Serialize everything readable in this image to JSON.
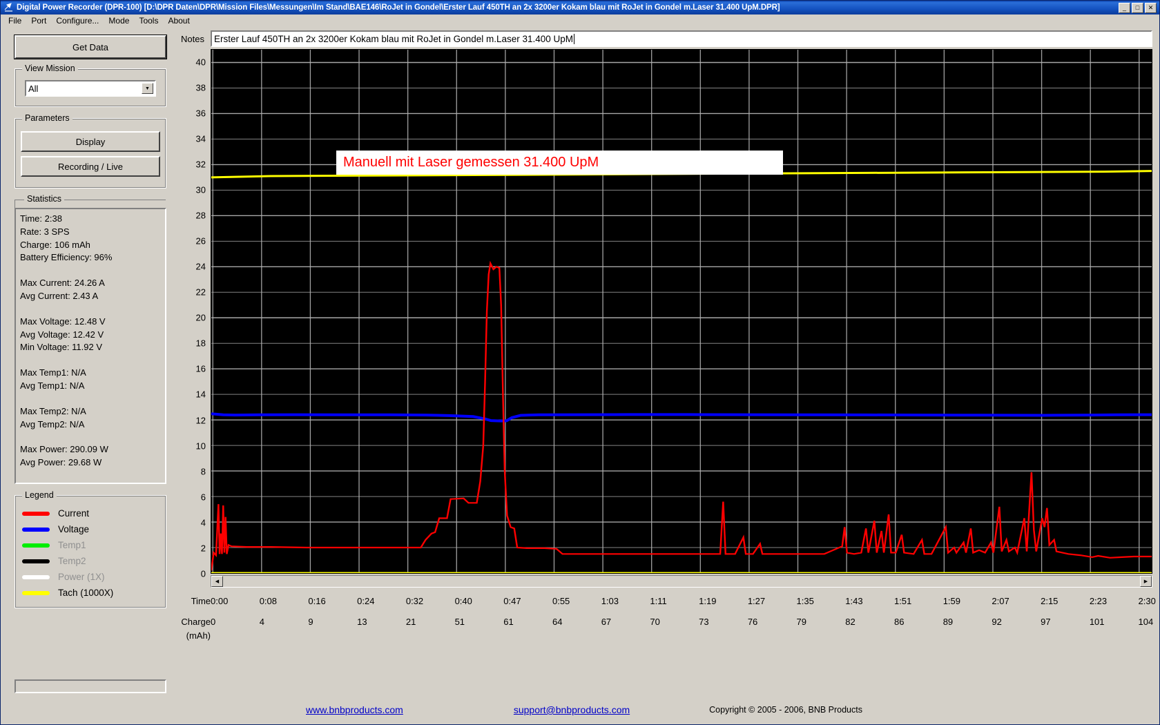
{
  "window": {
    "title": "Digital Power Recorder (DPR-100) [D:\\DPR Daten\\DPR\\Mission Files\\Messungen\\Im Stand\\BAE146\\RoJet in Gondel\\Erster Lauf 450TH an 2x 3200er Kokam blau mit RoJet in Gondel m.Laser 31.400 UpM.DPR]",
    "icon": "app-icon",
    "minimize": "_",
    "maximize": "□",
    "close": "✕"
  },
  "menu": {
    "items": [
      "File",
      "Port",
      "Configure...",
      "Mode",
      "Tools",
      "About"
    ]
  },
  "sidebar": {
    "get_data_label": "Get Data",
    "view_mission": {
      "title": "View Mission",
      "selected": "All",
      "options": [
        "All"
      ],
      "arrow": "▼"
    },
    "parameters": {
      "title": "Parameters",
      "display_label": "Display",
      "recording_label": "Recording / Live"
    },
    "statistics": {
      "title": "Statistics",
      "lines": [
        "Time: 2:38",
        "Rate: 3 SPS",
        "Charge: 106 mAh",
        "Battery Efficiency: 96%",
        "",
        "Max Current: 24.26 A",
        "Avg Current: 2.43 A",
        "",
        "Max Voltage: 12.48 V",
        "Avg Voltage: 12.42 V",
        "Min Voltage: 11.92 V",
        "",
        "Max Temp1: N/A",
        "Avg Temp1: N/A",
        "",
        "Max Temp2: N/A",
        "Avg Temp2: N/A",
        "",
        "Max Power: 290.09 W",
        "Avg Power: 29.68 W"
      ]
    },
    "legend": {
      "title": "Legend",
      "entries": [
        {
          "label": "Current",
          "color": "#ff0000",
          "enabled": true
        },
        {
          "label": "Voltage",
          "color": "#0000ff",
          "enabled": true
        },
        {
          "label": "Temp1",
          "color": "#00ee00",
          "enabled": false
        },
        {
          "label": "Temp2",
          "color": "#000000",
          "enabled": true
        },
        {
          "label": "Power  (1X)",
          "color": "#ffffff",
          "enabled": false
        },
        {
          "label": "Tach   (1000X)",
          "color": "#ffff00",
          "enabled": true
        }
      ]
    }
  },
  "notes": {
    "label": "Notes",
    "value": "Erster Lauf 450TH an 2x 3200er Kokam blau mit RoJet in Gondel m.Laser 31.400 UpM",
    "placeholder": ""
  },
  "scrollbar": {
    "left_arrow": "◀",
    "right_arrow": "▶"
  },
  "footer": {
    "website": "www.bnbproducts.com",
    "email": "support@bnbproducts.com",
    "copyright": "Copyright © 2005 - 2006, BNB Products"
  },
  "chart_data": {
    "type": "line",
    "title": "",
    "annotation": "Manuell mit Laser gemessen 31.400 UpM",
    "annotation_color": "#ff0000",
    "annotation_bg": "#ffffff",
    "plot_bg": "#000000",
    "grid": true,
    "grid_color": "#b0b0b0",
    "ylabel": "",
    "ylim": [
      0,
      41
    ],
    "yticks": [
      0,
      2,
      4,
      6,
      8,
      10,
      12,
      14,
      16,
      18,
      20,
      22,
      24,
      26,
      28,
      30,
      32,
      34,
      36,
      38,
      40
    ],
    "xlabel_time": "Time",
    "xlabel_charge": "Charge",
    "xlabel_charge_unit": "(mAh)",
    "xticks_time": [
      "0:00",
      "0:08",
      "0:16",
      "0:24",
      "0:32",
      "0:40",
      "0:47",
      "0:55",
      "1:03",
      "1:11",
      "1:19",
      "1:27",
      "1:35",
      "1:43",
      "1:51",
      "1:59",
      "2:07",
      "2:15",
      "2:23",
      "2:30"
    ],
    "xticks_charge": [
      "0",
      "4",
      "9",
      "13",
      "21",
      "51",
      "61",
      "64",
      "67",
      "70",
      "73",
      "76",
      "79",
      "82",
      "86",
      "89",
      "92",
      "97",
      "101",
      "104"
    ],
    "xlim": [
      0,
      158
    ],
    "legend_position": "left-panel",
    "series": [
      {
        "name": "Current",
        "color": "#ff0000",
        "unit": "A",
        "max": 24.26,
        "avg": 2.43,
        "points": [
          [
            0,
            0.2
          ],
          [
            0.4,
            1.6
          ],
          [
            0.8,
            1.4
          ],
          [
            1.2,
            5.4
          ],
          [
            1.4,
            1.5
          ],
          [
            1.6,
            3.1
          ],
          [
            1.8,
            1.5
          ],
          [
            2.0,
            5.3
          ],
          [
            2.2,
            1.6
          ],
          [
            2.4,
            4.4
          ],
          [
            2.6,
            1.5
          ],
          [
            2.9,
            2.2
          ],
          [
            3.4,
            2.1
          ],
          [
            6,
            2.05
          ],
          [
            10,
            2.05
          ],
          [
            16,
            2.0
          ],
          [
            22,
            2.0
          ],
          [
            28,
            2.0
          ],
          [
            33,
            2.0
          ],
          [
            35.2,
            2.0
          ],
          [
            36.0,
            2.6
          ],
          [
            37.0,
            3.1
          ],
          [
            37.6,
            3.2
          ],
          [
            38.3,
            4.3
          ],
          [
            39.6,
            4.3
          ],
          [
            40.2,
            5.8
          ],
          [
            42.4,
            5.85
          ],
          [
            43.2,
            5.5
          ],
          [
            44.6,
            5.5
          ],
          [
            45.2,
            7.2
          ],
          [
            45.7,
            10.0
          ],
          [
            46.0,
            15.0
          ],
          [
            46.3,
            20.5
          ],
          [
            46.6,
            23.4
          ],
          [
            46.9,
            24.26
          ],
          [
            47.4,
            23.8
          ],
          [
            47.9,
            24.0
          ],
          [
            48.4,
            23.9
          ],
          [
            48.7,
            21.0
          ],
          [
            49.0,
            14.0
          ],
          [
            49.3,
            8.0
          ],
          [
            49.7,
            4.5
          ],
          [
            50.3,
            3.6
          ],
          [
            50.9,
            3.5
          ],
          [
            51.4,
            2.0
          ],
          [
            53.0,
            1.95
          ],
          [
            56.0,
            1.95
          ],
          [
            58.0,
            1.9
          ],
          [
            59.0,
            1.5
          ],
          [
            62,
            1.5
          ],
          [
            66,
            1.5
          ],
          [
            70,
            1.5
          ],
          [
            74,
            1.5
          ],
          [
            78,
            1.5
          ],
          [
            82,
            1.5
          ],
          [
            85.5,
            1.5
          ],
          [
            86.0,
            5.6
          ],
          [
            86.4,
            1.5
          ],
          [
            88.0,
            1.5
          ],
          [
            89.4,
            2.8
          ],
          [
            89.8,
            1.5
          ],
          [
            91.0,
            1.5
          ],
          [
            92.2,
            2.3
          ],
          [
            92.6,
            1.5
          ],
          [
            95,
            1.5
          ],
          [
            99,
            1.5
          ],
          [
            103,
            1.5
          ],
          [
            106.0,
            2.1
          ],
          [
            106.4,
            3.6
          ],
          [
            106.8,
            1.6
          ],
          [
            108.0,
            1.5
          ],
          [
            109.2,
            1.6
          ],
          [
            110.0,
            3.5
          ],
          [
            110.4,
            1.6
          ],
          [
            111.4,
            4.1
          ],
          [
            111.8,
            1.6
          ],
          [
            112.6,
            3.3
          ],
          [
            113.0,
            1.6
          ],
          [
            113.8,
            4.6
          ],
          [
            114.2,
            1.6
          ],
          [
            115.0,
            1.6
          ],
          [
            116.0,
            3.0
          ],
          [
            116.4,
            1.6
          ],
          [
            118.0,
            1.5
          ],
          [
            119.4,
            2.6
          ],
          [
            119.8,
            1.5
          ],
          [
            121,
            1.5
          ],
          [
            123.4,
            3.6
          ],
          [
            123.8,
            1.6
          ],
          [
            124.8,
            2.0
          ],
          [
            125.2,
            1.6
          ],
          [
            126.4,
            2.4
          ],
          [
            126.8,
            1.6
          ],
          [
            127.6,
            3.5
          ],
          [
            128.0,
            1.6
          ],
          [
            129.0,
            1.8
          ],
          [
            130.0,
            1.6
          ],
          [
            131.0,
            2.4
          ],
          [
            131.4,
            1.6
          ],
          [
            132.4,
            5.2
          ],
          [
            132.8,
            1.7
          ],
          [
            133.6,
            2.6
          ],
          [
            134.0,
            1.7
          ],
          [
            135.0,
            2.0
          ],
          [
            135.4,
            1.6
          ],
          [
            136.6,
            4.3
          ],
          [
            137.0,
            1.7
          ],
          [
            137.8,
            7.9
          ],
          [
            138.2,
            3.4
          ],
          [
            138.6,
            1.7
          ],
          [
            139.6,
            4.3
          ],
          [
            140.0,
            3.6
          ],
          [
            140.4,
            5.1
          ],
          [
            140.8,
            2.2
          ],
          [
            141.6,
            2.6
          ],
          [
            142.0,
            1.7
          ],
          [
            143.0,
            1.6
          ],
          [
            144.0,
            1.5
          ],
          [
            146,
            1.4
          ],
          [
            148,
            1.25
          ],
          [
            149,
            1.35
          ],
          [
            151,
            1.2
          ],
          [
            153,
            1.25
          ],
          [
            155,
            1.3
          ],
          [
            158,
            1.3
          ]
        ]
      },
      {
        "name": "Voltage",
        "color": "#0000ff",
        "unit": "V",
        "max": 12.48,
        "avg": 12.42,
        "min": 11.92,
        "points": [
          [
            0,
            12.48
          ],
          [
            2,
            12.4
          ],
          [
            4,
            12.38
          ],
          [
            8,
            12.4
          ],
          [
            14,
            12.41
          ],
          [
            22,
            12.4
          ],
          [
            30,
            12.4
          ],
          [
            36,
            12.38
          ],
          [
            40,
            12.34
          ],
          [
            44,
            12.26
          ],
          [
            46,
            12.08
          ],
          [
            47,
            11.95
          ],
          [
            48.5,
            11.92
          ],
          [
            49.6,
            11.93
          ],
          [
            50.5,
            12.18
          ],
          [
            52,
            12.36
          ],
          [
            55,
            12.4
          ],
          [
            62,
            12.41
          ],
          [
            70,
            12.42
          ],
          [
            80,
            12.42
          ],
          [
            90,
            12.41
          ],
          [
            100,
            12.4
          ],
          [
            110,
            12.39
          ],
          [
            120,
            12.38
          ],
          [
            130,
            12.37
          ],
          [
            140,
            12.36
          ],
          [
            148,
            12.38
          ],
          [
            152,
            12.4
          ],
          [
            158,
            12.41
          ]
        ]
      },
      {
        "name": "Tach (1000X)",
        "color": "#ffff00",
        "unit": "UpM",
        "points_high": [
          [
            0,
            31.0
          ],
          [
            10,
            31.1
          ],
          [
            30,
            31.15
          ],
          [
            50,
            31.2
          ],
          [
            70,
            31.25
          ],
          [
            90,
            31.3
          ],
          [
            110,
            31.35
          ],
          [
            130,
            31.4
          ],
          [
            150,
            31.45
          ],
          [
            158,
            31.5
          ]
        ],
        "points_low": [
          [
            0,
            0
          ],
          [
            158,
            0
          ]
        ]
      }
    ]
  }
}
